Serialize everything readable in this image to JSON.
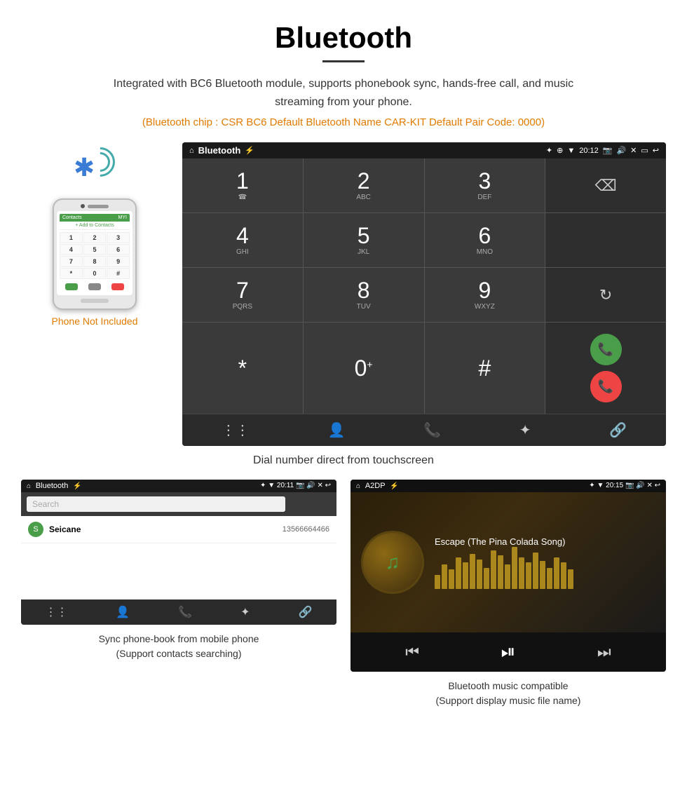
{
  "header": {
    "title": "Bluetooth",
    "subtitle": "Integrated with BC6 Bluetooth module, supports phonebook sync, hands-free call, and music streaming from your phone.",
    "bluetooth_info": "(Bluetooth chip : CSR BC6    Default Bluetooth Name CAR-KIT    Default Pair Code: 0000)"
  },
  "phone_mockup": {
    "not_included_label": "Phone Not Included",
    "screen_header": "+ Add to Contacts",
    "keys": [
      "1",
      "2",
      "3",
      "4",
      "5",
      "6",
      "7",
      "8",
      "9",
      "*",
      "0",
      "#"
    ]
  },
  "android_screen": {
    "status_bar": {
      "app_name": "Bluetooth",
      "time": "20:12",
      "icons": "✦ ❋ ▼"
    },
    "dialpad": {
      "keys": [
        {
          "number": "1",
          "letters": ""
        },
        {
          "number": "2",
          "letters": "ABC"
        },
        {
          "number": "3",
          "letters": "DEF"
        },
        {
          "number": "",
          "letters": "",
          "special": "backspace"
        },
        {
          "number": "4",
          "letters": "GHI"
        },
        {
          "number": "5",
          "letters": "JKL"
        },
        {
          "number": "6",
          "letters": "MNO"
        },
        {
          "number": "",
          "letters": "",
          "special": "empty"
        },
        {
          "number": "7",
          "letters": "PQRS"
        },
        {
          "number": "8",
          "letters": "TUV"
        },
        {
          "number": "9",
          "letters": "WXYZ"
        },
        {
          "number": "",
          "letters": "",
          "special": "refresh"
        },
        {
          "number": "*",
          "letters": ""
        },
        {
          "number": "0",
          "letters": "+"
        },
        {
          "number": "#",
          "letters": ""
        },
        {
          "number": "",
          "letters": "",
          "special": "call_end"
        }
      ]
    },
    "bottom_nav_icons": [
      "⋮⋮⋮",
      "👤",
      "📞",
      "✦",
      "🔗"
    ]
  },
  "main_caption": "Dial number direct from touchscreen",
  "phonebook_screen": {
    "status_bar": {
      "app_name": "Bluetooth",
      "time": "20:11"
    },
    "search_placeholder": "Search",
    "contacts": [
      {
        "letter": "S",
        "name": "Seicane",
        "number": "13566664466"
      }
    ],
    "caption_line1": "Sync phone-book from mobile phone",
    "caption_line2": "(Support contacts searching)"
  },
  "music_screen": {
    "status_bar": {
      "app_name": "A2DP",
      "time": "20:15"
    },
    "song_title": "Escape (The Pina Colada Song)",
    "music_bars": [
      20,
      35,
      28,
      45,
      38,
      50,
      42,
      30,
      55,
      48,
      35,
      60,
      45,
      38,
      52,
      40,
      30,
      45,
      38,
      28
    ],
    "caption_line1": "Bluetooth music compatible",
    "caption_line2": "(Support display music file name)"
  }
}
